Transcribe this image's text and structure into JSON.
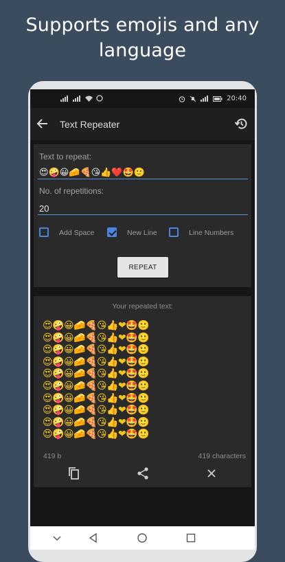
{
  "promo": {
    "line1": "Supports emojis and any",
    "line2": "language"
  },
  "statusbar": {
    "time": "20:40",
    "icons": [
      "signal-icon",
      "signal-icon",
      "wifi-icon",
      "whatsapp-icon",
      "alarm-icon",
      "mute-icon",
      "signal-icon",
      "battery-icon"
    ]
  },
  "appbar": {
    "title": "Text Repeater"
  },
  "form": {
    "text_label": "Text to repeat:",
    "text_value": "😍🤪😀🧀🍕😘👍❤️🤩🙂",
    "reps_label": "No. of repetitions:",
    "reps_value": "20",
    "options": [
      {
        "label": "Add Space",
        "checked": false
      },
      {
        "label": "New Line",
        "checked": true
      },
      {
        "label": "Line Numbers",
        "checked": false
      }
    ],
    "repeat_label": "REPEAT"
  },
  "result": {
    "header": "Your repeated text:",
    "line": "😍🤪😀🧀🍕😘👍❤🤩🙂",
    "visible_lines": 10,
    "size": "419 b",
    "chars": "419 characters"
  },
  "colors": {
    "background": "#3b4c5e",
    "accent": "#4a86e0",
    "card": "#2a2a2a",
    "screen": "#161616"
  }
}
